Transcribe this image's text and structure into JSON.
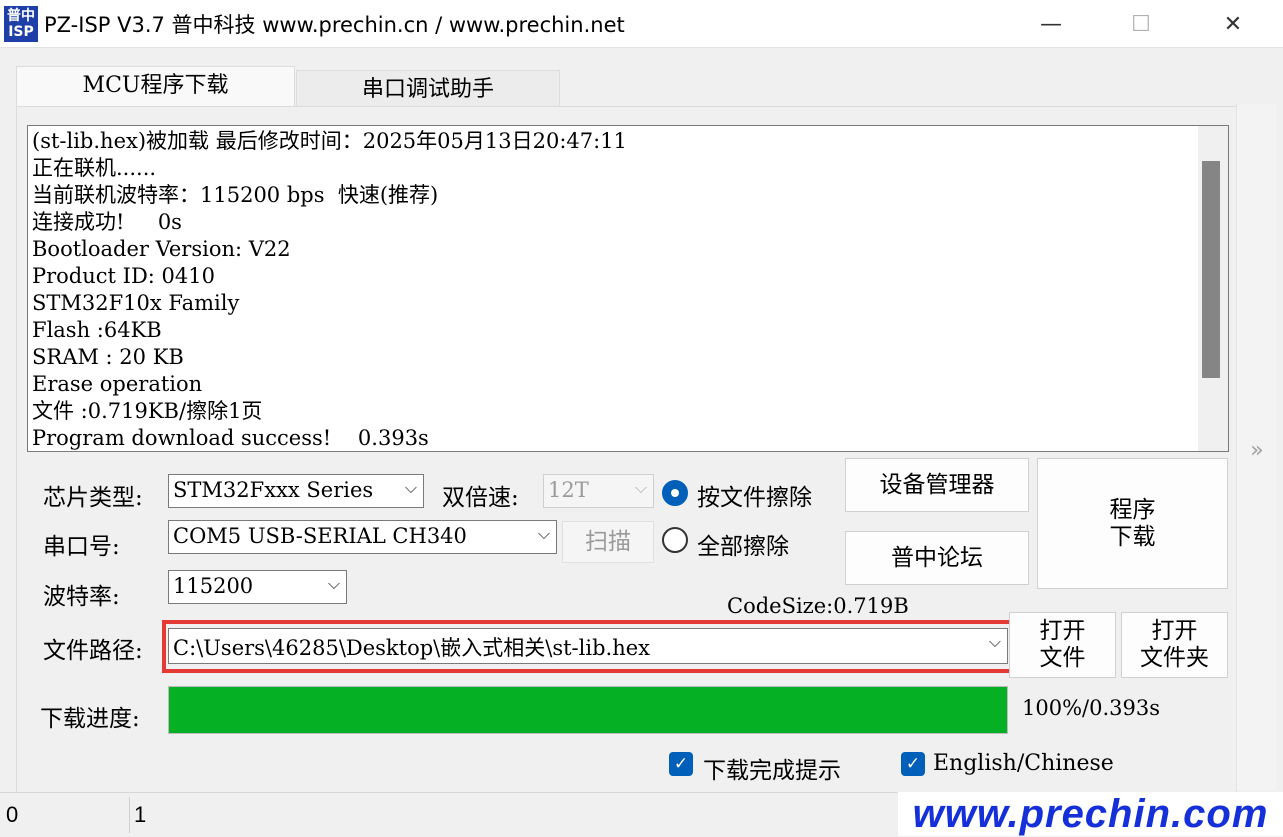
{
  "window": {
    "icon_text": "普中\nISP",
    "title": "PZ-ISP V3.7 普中科技  www.prechin.cn / www.prechin.net",
    "minimize": "—",
    "maximize": "☐",
    "close": "✕"
  },
  "tabs": [
    {
      "label": "MCU程序下载",
      "active": true
    },
    {
      "label": "串口调试助手",
      "active": false
    }
  ],
  "log": {
    "lines": [
      "(st-lib.hex)被加载 最后修改时间：2025年05月13日20:47:11",
      "正在联机......",
      "当前联机波特率：115200 bps  快速(推荐)",
      "连接成功!     0s",
      "Bootloader Version: V22",
      "Product ID: 0410",
      "STM32F10x Family",
      "Flash :64KB",
      "SRAM : 20 KB",
      "Erase operation",
      "文件 :0.719KB/擦除1页",
      "Program download success!    0.393s"
    ]
  },
  "settings": {
    "chip_type_label": "芯片类型:",
    "chip_type_value": "STM32Fxxx Series",
    "double_speed_label": "双倍速:",
    "double_speed_value": "12T",
    "erase_by_file_label": "按文件擦除",
    "erase_all_label": "全部擦除",
    "port_label": "串口号:",
    "port_value": "COM5  USB-SERIAL CH340",
    "scan_button": "扫描",
    "baud_label": "波特率:",
    "baud_value": "115200",
    "code_size": "CodeSize:0.719B",
    "file_path_label": "文件路径:",
    "file_path_value": "C:\\Users\\46285\\Desktop\\嵌入式相关\\st-lib.hex",
    "progress_label": "下载进度:",
    "progress_fraction": 1.0,
    "progress_text": "100%/0.393s"
  },
  "buttons": {
    "device_manager": "设备管理器",
    "forum": "普中论坛",
    "program_download_line1": "程序",
    "program_download_line2": "下载",
    "open_file_line1": "打开",
    "open_file_line2": "文件",
    "open_folder_line1": "打开",
    "open_folder_line2": "文件夹"
  },
  "checkboxes": {
    "download_complete_prompt": "下载完成提示",
    "english_chinese": "English/Chinese"
  },
  "statusbar": {
    "cell1": "0",
    "cell2": "1"
  },
  "watermark": "www.prechin.com",
  "side_arrow": "»",
  "colors": {
    "progress_fill": "#06b025",
    "accent": "#005fb8",
    "highlight_box": "#e53935",
    "watermark": "#1530d8"
  }
}
